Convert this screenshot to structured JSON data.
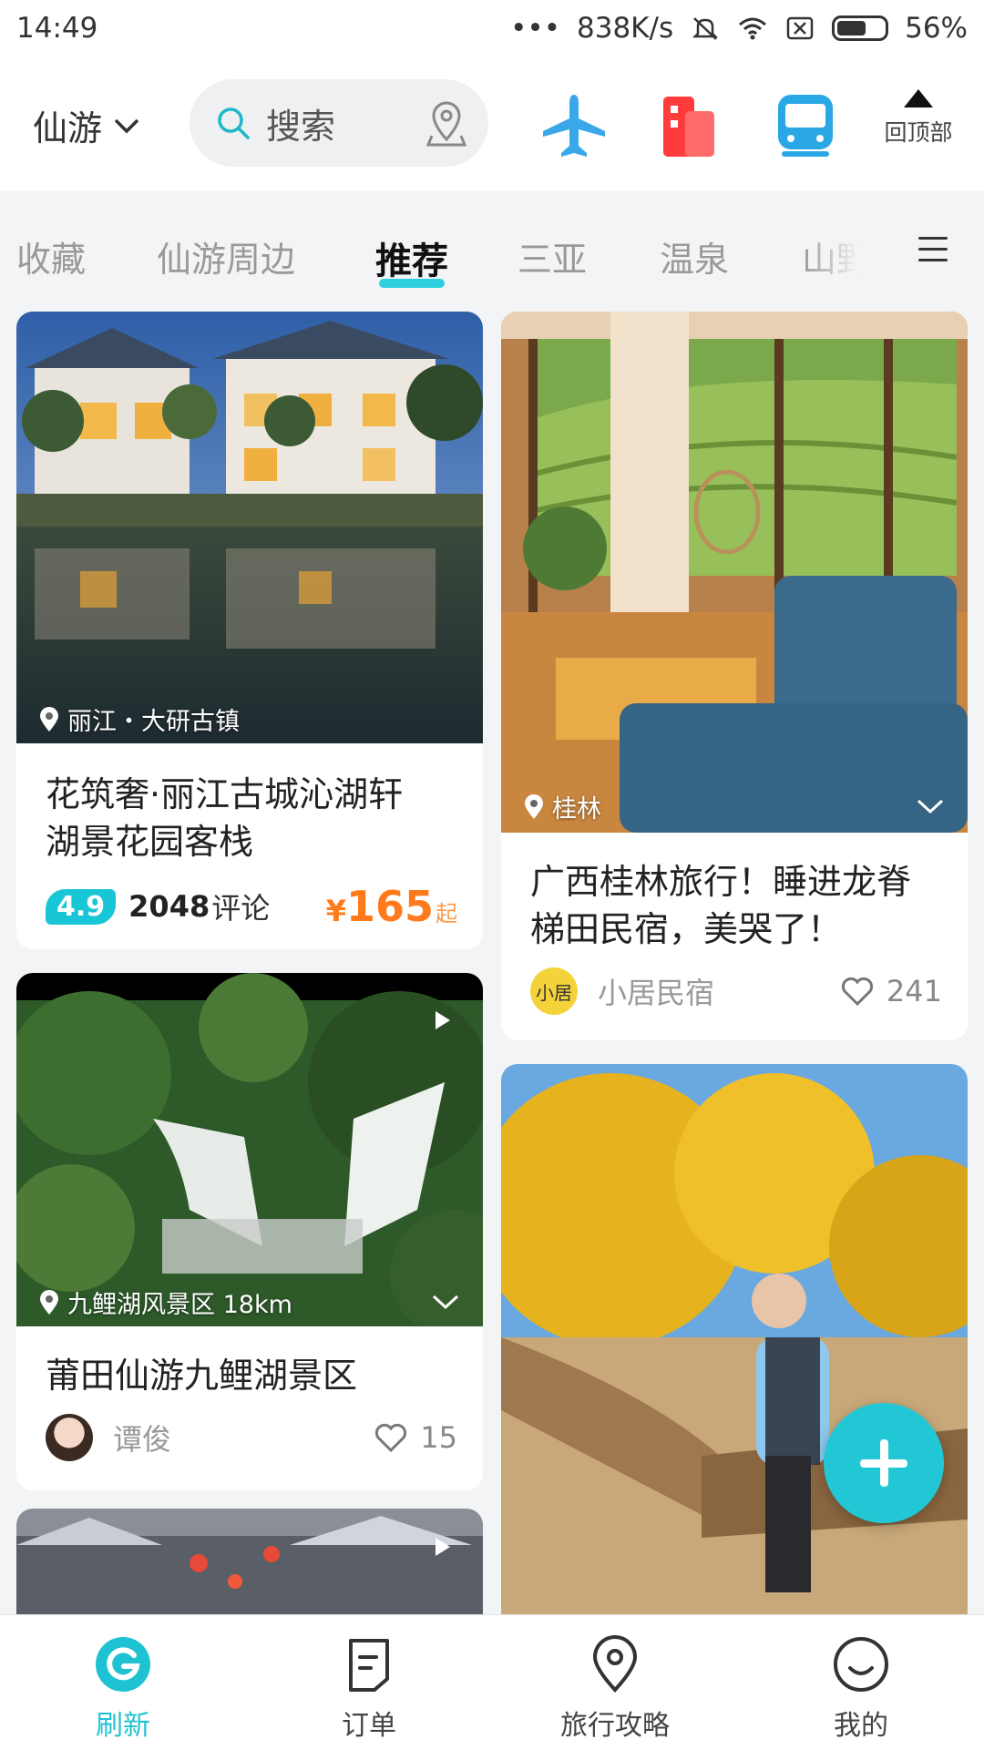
{
  "status_bar": {
    "time": "14:49",
    "dots": "•••",
    "speed": "838K/s",
    "battery": "56%"
  },
  "header": {
    "city": "仙游",
    "search_label": "搜索",
    "back_to_top": "回顶部",
    "icons": [
      "plane-icon",
      "hotel-icon",
      "train-icon"
    ]
  },
  "tabs": {
    "items": [
      "收藏",
      "仙游周边",
      "推荐",
      "三亚",
      "温泉",
      "山野"
    ],
    "active": "推荐"
  },
  "cards": {
    "c1": {
      "location": "丽江・大研古镇",
      "title_line1": "花筑奢·丽江古城沁湖轩",
      "title_line2": "湖景花园客栈",
      "rating": "4.9",
      "reviews": "2048",
      "reviews_unit": "评论",
      "price_symbol": "¥",
      "price": "165",
      "price_suffix": "起"
    },
    "c2": {
      "location": "桂林",
      "title_line1": "广西桂林旅行！睡进龙脊",
      "title_line2": "梯田民宿，美哭了！",
      "author": "小居民宿",
      "avatar_text": "小居",
      "likes": "241"
    },
    "c3": {
      "location": "九鲤湖风景区 18km",
      "title": "莆田仙游九鲤湖景区",
      "author": "谭俊",
      "likes": "15"
    }
  },
  "bottom_nav": {
    "items": [
      "刷新",
      "订单",
      "旅行攻略",
      "我的"
    ],
    "active": "刷新"
  },
  "colors": {
    "accent": "#1fc2d2",
    "price": "#ff7a1a",
    "rating_bg": "#19c6d6"
  }
}
